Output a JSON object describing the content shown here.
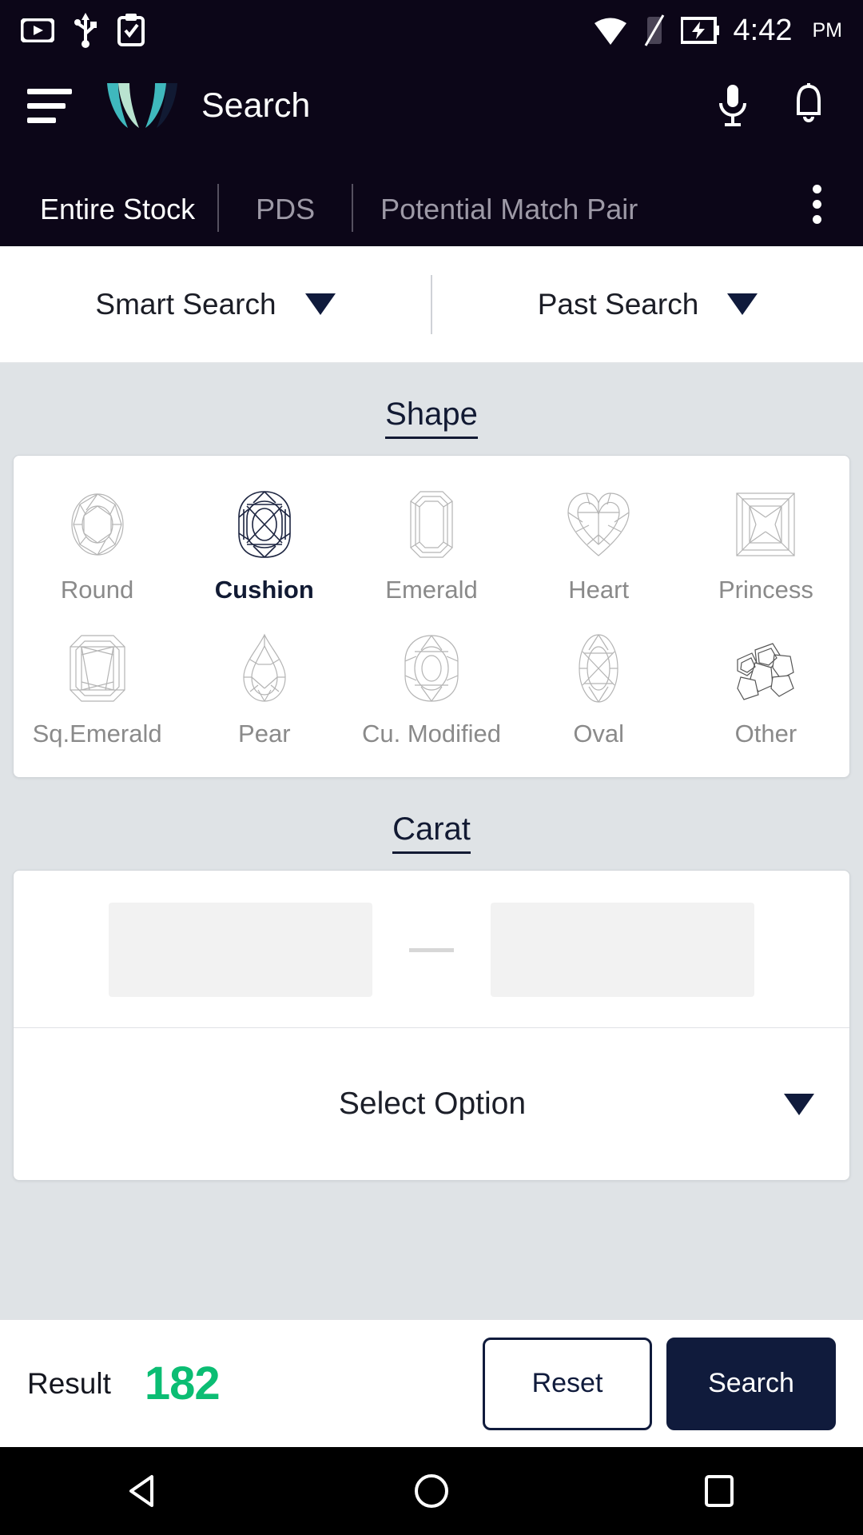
{
  "status_bar": {
    "icons_left": [
      "youtube-icon",
      "usb-icon",
      "clipboard-check-icon"
    ],
    "icons_right": [
      "wifi-icon",
      "sim-off-icon",
      "battery-charging-icon"
    ],
    "time": "4:42",
    "ampm": "PM"
  },
  "app_bar": {
    "menu_icon": "hamburger-icon",
    "logo": "wave-logo",
    "title": "Search",
    "mic_icon": "microphone-icon",
    "bell_icon": "notification-bell-icon"
  },
  "tabs": {
    "items": [
      {
        "label": "Entire Stock",
        "active": true
      },
      {
        "label": "PDS",
        "active": false
      },
      {
        "label": "Potential Match Pair",
        "active": false
      }
    ],
    "overflow_icon": "kebab-menu-icon"
  },
  "sub_bar": {
    "items": [
      {
        "label": "Smart Search",
        "icon": "chevron-down-icon"
      },
      {
        "label": "Past Search",
        "icon": "chevron-down-icon"
      }
    ]
  },
  "shape_section": {
    "title": "Shape",
    "options": [
      {
        "label": "Round",
        "icon": "round-diamond-icon",
        "selected": false
      },
      {
        "label": "Cushion",
        "icon": "cushion-diamond-icon",
        "selected": true
      },
      {
        "label": "Emerald",
        "icon": "emerald-diamond-icon",
        "selected": false
      },
      {
        "label": "Heart",
        "icon": "heart-diamond-icon",
        "selected": false
      },
      {
        "label": "Princess",
        "icon": "princess-diamond-icon",
        "selected": false
      },
      {
        "label": "Sq.Emerald",
        "icon": "square-emerald-diamond-icon",
        "selected": false
      },
      {
        "label": "Pear",
        "icon": "pear-diamond-icon",
        "selected": false
      },
      {
        "label": "Cu. Modified",
        "icon": "cushion-modified-icon",
        "selected": false
      },
      {
        "label": "Oval",
        "icon": "oval-diamond-icon",
        "selected": false
      },
      {
        "label": "Other",
        "icon": "other-diamonds-icon",
        "selected": false
      }
    ]
  },
  "carat_section": {
    "title": "Carat",
    "from_value": "",
    "from_placeholder": "",
    "to_value": "",
    "to_placeholder": "",
    "separator": "—",
    "select_label": "Select Option",
    "select_icon": "chevron-down-icon"
  },
  "footer": {
    "result_label": "Result",
    "result_count": "182",
    "reset_label": "Reset",
    "search_label": "Search"
  },
  "nav_bar": {
    "back_icon": "back-triangle-icon",
    "home_icon": "home-circle-icon",
    "recents_icon": "recents-square-icon"
  },
  "colors": {
    "header_bg": "#0c0618",
    "accent_navy": "#101b3c",
    "result_green": "#0bbd73",
    "body_bg": "#dfe3e6",
    "logo_teal": "#3fb8bd",
    "logo_mint": "#b9e3d0"
  }
}
